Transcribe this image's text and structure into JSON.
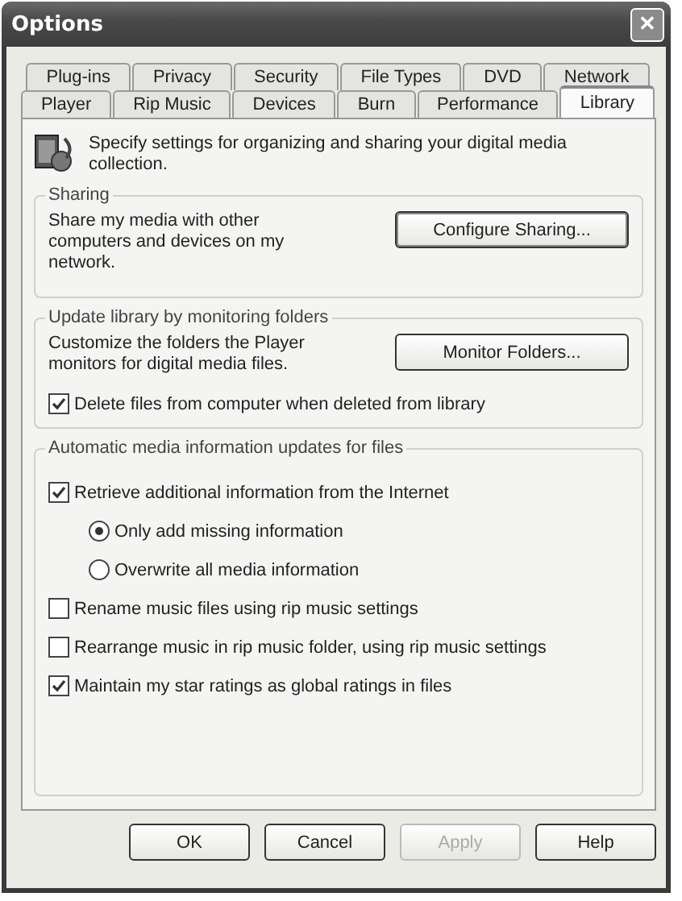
{
  "window": {
    "title": "Options",
    "close": "✕"
  },
  "tab_rows": [
    [
      {
        "label": "Plug-ins",
        "selected": false
      },
      {
        "label": "Privacy",
        "selected": false
      },
      {
        "label": "Security",
        "selected": false
      },
      {
        "label": "File Types",
        "selected": false
      },
      {
        "label": "DVD",
        "selected": false
      },
      {
        "label": "Network",
        "selected": false
      }
    ],
    [
      {
        "label": "Player",
        "selected": false
      },
      {
        "label": "Rip Music",
        "selected": false
      },
      {
        "label": "Devices",
        "selected": false
      },
      {
        "label": "Burn",
        "selected": false
      },
      {
        "label": "Performance",
        "selected": false
      },
      {
        "label": "Library",
        "selected": true
      }
    ]
  ],
  "intro": "Specify settings for organizing and sharing your digital media collection.",
  "sharing": {
    "legend": "Sharing",
    "text": "Share my media with other computers and devices on my network.",
    "button": "Configure Sharing..."
  },
  "monitoring": {
    "legend": "Update library by monitoring folders",
    "text": "Customize the folders the Player monitors for digital media files.",
    "button": "Monitor Folders...",
    "options": [
      {
        "kind": "checkbox",
        "label": "Delete files from computer when deleted from library",
        "checked": true
      }
    ]
  },
  "updates": {
    "legend": "Automatic media information updates for files",
    "options": [
      {
        "kind": "checkbox",
        "label": "Retrieve additional information from the Internet",
        "checked": true
      },
      {
        "kind": "radio",
        "label": "Only add missing information",
        "checked": true
      },
      {
        "kind": "radio",
        "label": "Overwrite all media information",
        "checked": false
      },
      {
        "kind": "checkbox",
        "label": "Rename music files using rip music settings",
        "checked": false
      },
      {
        "kind": "checkbox",
        "label": "Rearrange music in rip music folder, using rip music settings",
        "checked": false
      },
      {
        "kind": "checkbox",
        "label": "Maintain my star ratings as global ratings in files",
        "checked": true
      }
    ]
  },
  "buttons": [
    {
      "label": "OK",
      "disabled": false
    },
    {
      "label": "Cancel",
      "disabled": false
    },
    {
      "label": "Apply",
      "disabled": true
    },
    {
      "label": "Help",
      "disabled": false
    }
  ]
}
